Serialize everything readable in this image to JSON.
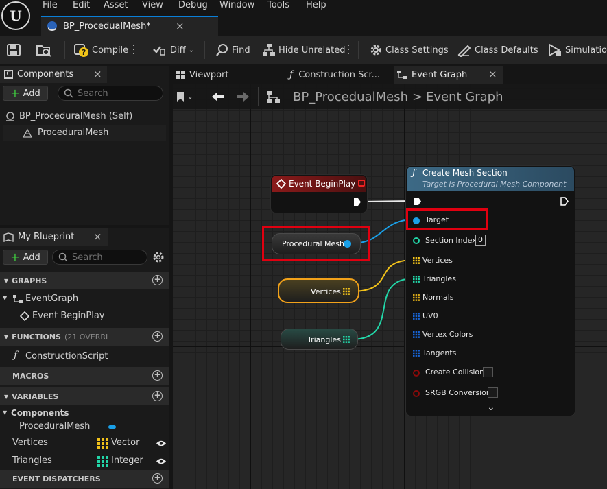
{
  "menu": [
    "File",
    "Edit",
    "Asset",
    "View",
    "Debug",
    "Window",
    "Tools",
    "Help"
  ],
  "doc_tab": {
    "title": "BP_ProcedualMesh*",
    "close": "×"
  },
  "toolbar": {
    "compile": "Compile",
    "diff": "Diff",
    "find": "Find",
    "hide_unrelated": "Hide Unrelated",
    "class_settings": "Class Settings",
    "class_defaults": "Class Defaults",
    "simulation": "Simulation"
  },
  "components_panel": {
    "tab": "Components",
    "close": "×",
    "add": "Add",
    "search_placeholder": "Search",
    "items": [
      "BP_ProceduralMesh (Self)",
      "ProceduralMesh"
    ]
  },
  "my_blueprint": {
    "tab": "My Blueprint",
    "close": "×",
    "add": "Add",
    "search_placeholder": "Search",
    "graphs_header": "GRAPHS",
    "graphs": [
      "EventGraph",
      "Event BeginPlay"
    ],
    "functions_header": "FUNCTIONS",
    "functions_count": "(21 OVERRI",
    "functions": [
      "ConstructionScript"
    ],
    "macros_header": "MACROS",
    "variables_header": "VARIABLES",
    "components_group": "Components",
    "variables": [
      {
        "name": "ProceduralMesh",
        "type": "",
        "color": "#1aa0e8"
      },
      {
        "name": "Vertices",
        "type": "Vector",
        "color": "#f2c21a"
      },
      {
        "name": "Triangles",
        "type": "Integer",
        "color": "#22d6a8"
      }
    ],
    "dispatchers_header": "EVENT DISPATCHERS"
  },
  "graph_tabs": [
    "Viewport",
    "Construction Scr...",
    "Event Graph"
  ],
  "graph_tab_close": "×",
  "breadcrumb": {
    "blueprint": "BP_ProcedualMesh",
    "separator": ">",
    "graph": "Event Graph"
  },
  "nodes": {
    "begin_play": {
      "title": "Event BeginPlay"
    },
    "procedural_mesh": {
      "label": "Procedural Mesh"
    },
    "vertices": {
      "label": "Vertices"
    },
    "triangles": {
      "label": "Triangles"
    },
    "create_mesh_section": {
      "title": "Create Mesh Section",
      "subtitle": "Target is Procedural Mesh Component",
      "pins": [
        "Target",
        "Section Index",
        "Vertices",
        "Triangles",
        "Normals",
        "UV0",
        "Vertex Colors",
        "Tangents",
        "Create Collision",
        "SRGB Conversion"
      ],
      "section_index_value": "0"
    }
  },
  "colors": {
    "object_pin": "#1aa0e8",
    "vector_pin": "#f2c21a",
    "integer_pin": "#22d6a8",
    "struct_pin": "#1764d6",
    "bool_pin": "#8a0a0a",
    "highlight": "#e00010",
    "event_header": "#8b1a1a",
    "function_header": "#3d6a86"
  }
}
